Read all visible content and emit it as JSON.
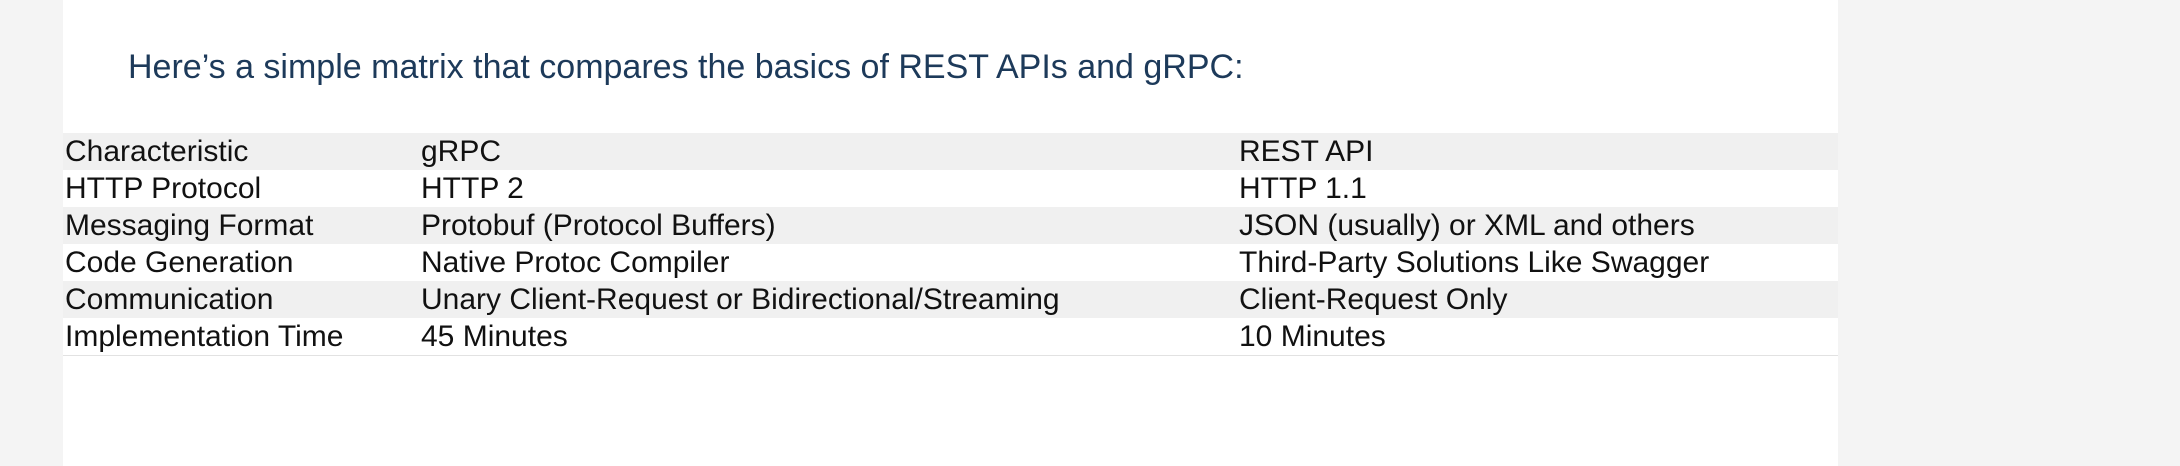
{
  "intro": "Here’s a simple matrix that compares the basics of REST APIs and gRPC:",
  "table": {
    "header": [
      "Characteristic",
      "gRPC",
      "REST API"
    ],
    "rows": [
      [
        "HTTP Protocol",
        "HTTP 2",
        "HTTP 1.1"
      ],
      [
        "Messaging Format",
        "Protobuf (Protocol Buffers)",
        "JSON (usually) or XML and others"
      ],
      [
        "Code Generation",
        "Native Protoc Compiler",
        "Third-Party Solutions Like Swagger"
      ],
      [
        "Communication",
        "Unary Client-Request or Bidirectional/Streaming",
        "Client-Request Only"
      ],
      [
        "Implementation Time",
        "45 Minutes",
        "10 Minutes"
      ]
    ]
  },
  "colors": {
    "intro_text": "#1d3a5a",
    "row_shade": "#f0f0f0",
    "page_background": "#f4f4f4",
    "content_background": "#ffffff"
  }
}
